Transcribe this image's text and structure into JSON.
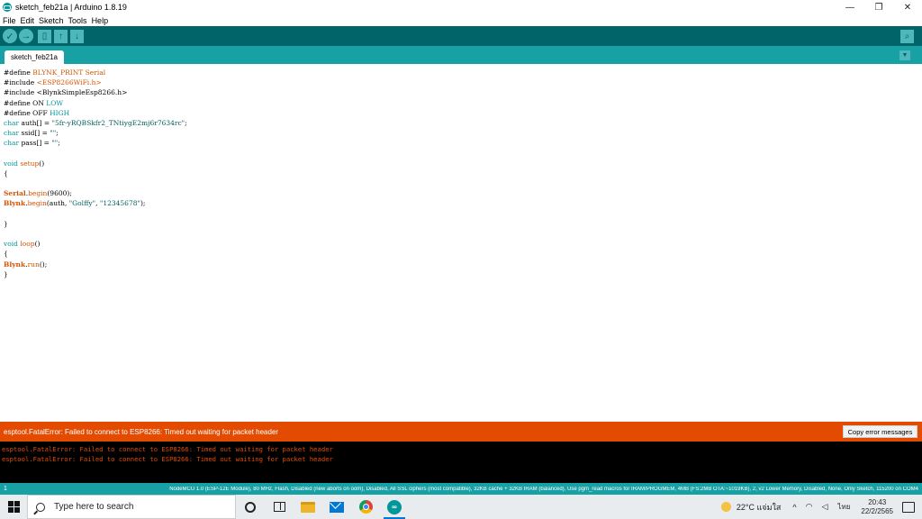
{
  "window": {
    "title": "sketch_feb21a | Arduino 1.8.19",
    "minimize": "—",
    "maximize": "❐",
    "close": "✕"
  },
  "menu": [
    "File",
    "Edit",
    "Sketch",
    "Tools",
    "Help"
  ],
  "toolbar": {
    "verify_icon": "check-icon",
    "upload_icon": "arrow-right-icon",
    "new_icon": "new-file-icon",
    "open_icon": "arrow-up-icon",
    "save_icon": "arrow-down-icon",
    "serial_icon": "magnifier-icon"
  },
  "tab": {
    "label": "sketch_feb21a",
    "menu_glyph": "▼"
  },
  "code": [
    [
      {
        "t": "#define ",
        "c": "n"
      },
      {
        "t": "BLYNK_PRINT Serial",
        "c": "o"
      }
    ],
    [
      {
        "t": "#include ",
        "c": "n"
      },
      {
        "t": "<ESP8266WiFi.h>",
        "c": "o"
      }
    ],
    [
      {
        "t": "#include <BlynkSimpleEsp8266.h>",
        "c": "n"
      }
    ],
    [
      {
        "t": "#define ON ",
        "c": "n"
      },
      {
        "t": "LOW",
        "c": "t"
      }
    ],
    [
      {
        "t": "#define OFF ",
        "c": "n"
      },
      {
        "t": "HIGH",
        "c": "t"
      }
    ],
    [
      {
        "t": "char",
        "c": "t"
      },
      {
        "t": " auth[] = ",
        "c": "n"
      },
      {
        "t": "\"5fr-yRQBSkfr2_TNtiygE2mj6r7634rc\"",
        "c": "s"
      },
      {
        "t": ";",
        "c": "n"
      }
    ],
    [
      {
        "t": "char",
        "c": "t"
      },
      {
        "t": " ssid[] = ",
        "c": "n"
      },
      {
        "t": "\"\"",
        "c": "s"
      },
      {
        "t": ";",
        "c": "n"
      }
    ],
    [
      {
        "t": "char",
        "c": "t"
      },
      {
        "t": " pass[] = ",
        "c": "n"
      },
      {
        "t": "\"\"",
        "c": "s"
      },
      {
        "t": ";",
        "c": "n"
      }
    ],
    [],
    [
      {
        "t": "void",
        "c": "t"
      },
      {
        "t": " ",
        "c": "n"
      },
      {
        "t": "setup",
        "c": "o"
      },
      {
        "t": "()",
        "c": "n"
      }
    ],
    [
      {
        "t": "{",
        "c": "n"
      }
    ],
    [],
    [
      {
        "t": "Serial",
        "c": "b"
      },
      {
        "t": ".",
        "c": "n"
      },
      {
        "t": "begin",
        "c": "o"
      },
      {
        "t": "(9600);",
        "c": "n"
      }
    ],
    [
      {
        "t": "Blynk",
        "c": "b"
      },
      {
        "t": ".",
        "c": "n"
      },
      {
        "t": "begin",
        "c": "o"
      },
      {
        "t": "(auth, ",
        "c": "n"
      },
      {
        "t": "\"Golffy\"",
        "c": "s"
      },
      {
        "t": ", ",
        "c": "n"
      },
      {
        "t": "\"12345678\"",
        "c": "s"
      },
      {
        "t": ");",
        "c": "n"
      }
    ],
    [],
    [
      {
        "t": "}",
        "c": "n"
      }
    ],
    [],
    [
      {
        "t": "void",
        "c": "t"
      },
      {
        "t": " ",
        "c": "n"
      },
      {
        "t": "loop",
        "c": "o"
      },
      {
        "t": "()",
        "c": "n"
      }
    ],
    [
      {
        "t": "{",
        "c": "n"
      }
    ],
    [
      {
        "t": "Blynk",
        "c": "b"
      },
      {
        "t": ".",
        "c": "n"
      },
      {
        "t": "run",
        "c": "o"
      },
      {
        "t": "();",
        "c": "n"
      }
    ],
    [
      {
        "t": "}",
        "c": "n"
      }
    ]
  ],
  "error_bar": {
    "message": "esptool.FatalError: Failed to connect to ESP8266: Timed out waiting for packet header",
    "copy_button": "Copy error messages"
  },
  "console": [
    "esptool.FatalError: Failed to connect to ESP8266: Timed out waiting for packet header",
    "esptool.FatalError: Failed to connect to ESP8266: Timed out waiting for packet header"
  ],
  "status_bar": {
    "line": "1",
    "board": "NodeMCU 1.0 (ESP-12E Module), 80 MHz, Flash, Disabled (new aborts on oom), Disabled, All SSL ciphers (most compatible), 32KB cache + 32KB IRAM (balanced), Use pgm_read macros for IRAM/PROGMEM, 4MB (FS:2MB OTA:~1019KB), 2, v2 Lower Memory, Disabled, None, Only Sketch, 115200 on COM4"
  },
  "taskbar": {
    "search_placeholder": "Type here to search",
    "weather": "22°C แจ่มใส",
    "up_arrow": "^",
    "language": "ไทย",
    "time": "20:43",
    "date": "22/2/2565"
  },
  "colors": {
    "toolbar": "#006468",
    "tabbar": "#17a1a5",
    "error": "#e34c00",
    "console_bg": "#000000"
  }
}
